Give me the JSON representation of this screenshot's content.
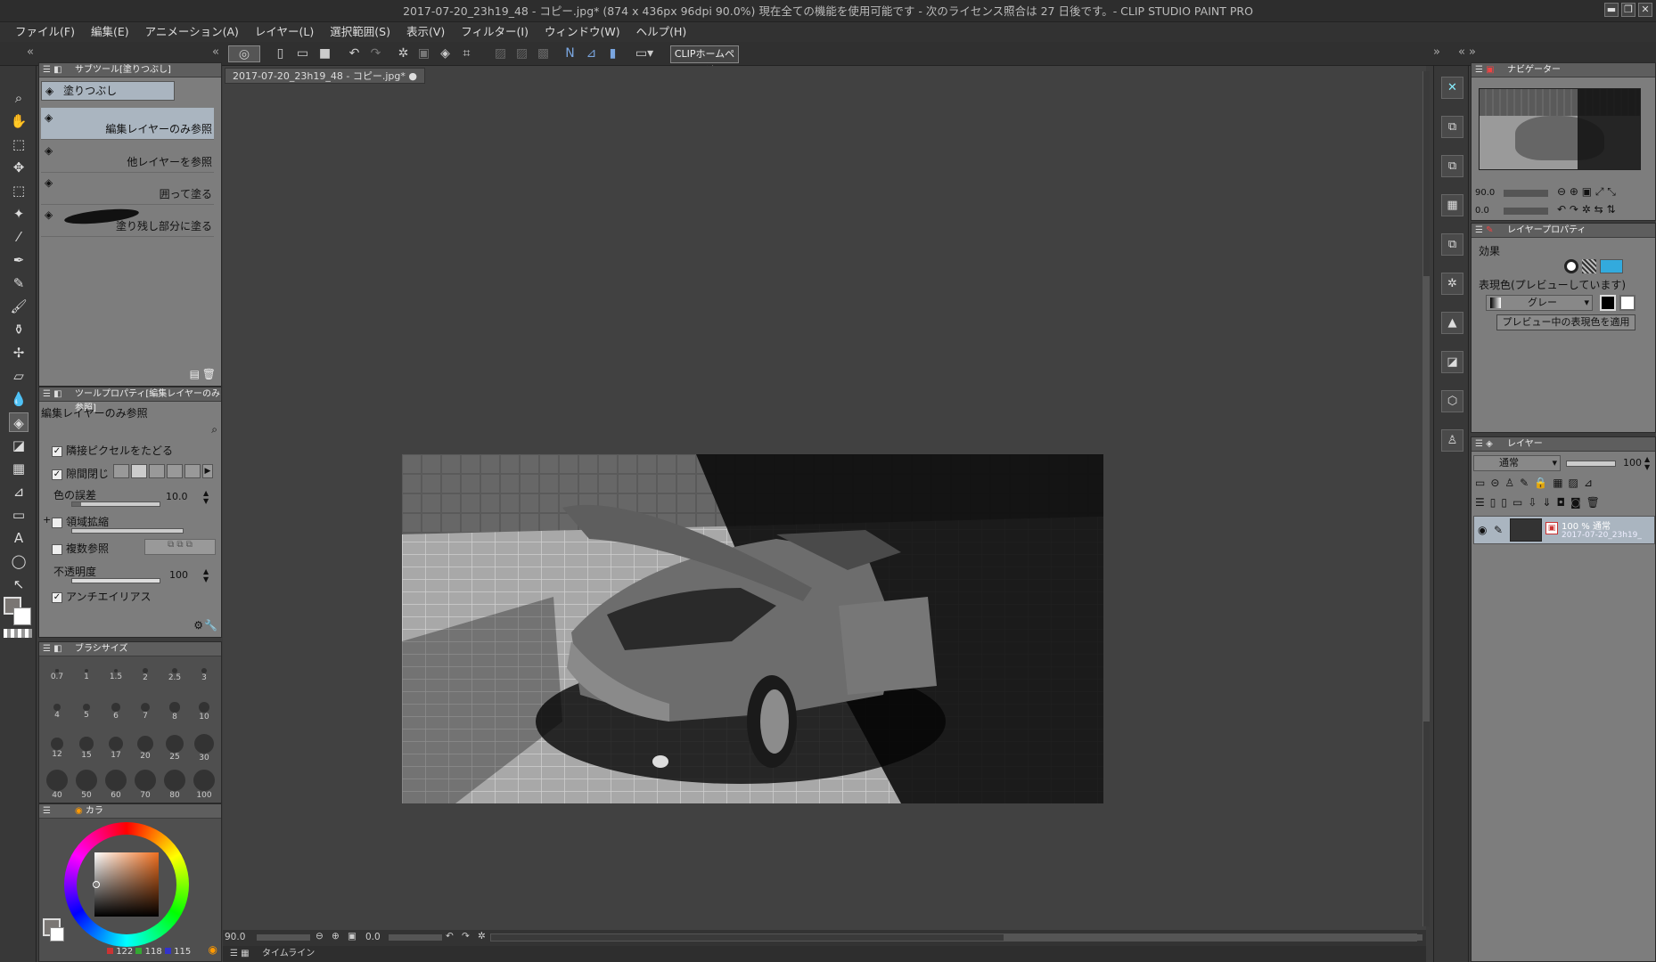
{
  "window": {
    "title": "2017-07-20_23h19_48 - コピー.jpg* (874 x 436px 96dpi 90.0%)  現在全ての機能を使用可能です - 次のライセンス照合は 27 日後です。- CLIP STUDIO PAINT PRO",
    "minimize": "▬",
    "restore": "❐",
    "close": "✕"
  },
  "menu": [
    "ファイル(F)",
    "編集(E)",
    "アニメーション(A)",
    "レイヤー(L)",
    "選択範囲(S)",
    "表示(V)",
    "フィルター(I)",
    "ウィンドウ(W)",
    "ヘルプ(H)"
  ],
  "toolbar": {
    "home_label": "CLIPホームページ"
  },
  "subtool": {
    "header": "サブツール[塗りつぶし]",
    "group_label": "塗りつぶし",
    "items": [
      "編集レイヤーのみ参照",
      "他レイヤーを参照",
      "囲って塗る",
      "塗り残し部分に塗る"
    ]
  },
  "tool_property": {
    "header": "ツールプロパティ[編集レイヤーのみ参照]",
    "title": "編集レイヤーのみ参照",
    "adjacent_label": "隣接ピクセルをたどる",
    "gap_label": "隙間閉じ",
    "color_margin_label": "色の誤差",
    "color_margin_value": "10.0",
    "area_scaling_label": "領域拡縮",
    "multi_ref_label": "複数参照",
    "opacity_label": "不透明度",
    "opacity_value": "100",
    "antialias_label": "アンチエイリアス"
  },
  "brush_size": {
    "header": "ブラシサイズ",
    "sizes": [
      "0.7",
      "1",
      "1.5",
      "2",
      "2.5",
      "3",
      "4",
      "5",
      "6",
      "7",
      "8",
      "10",
      "12",
      "15",
      "17",
      "20",
      "25",
      "30",
      "40",
      "50",
      "60",
      "70",
      "80",
      "100"
    ]
  },
  "color": {
    "header": "カラ",
    "r": "122",
    "g": "118",
    "b": "115",
    "main_color": "#7a7673"
  },
  "canvas": {
    "doc_tab": "2017-07-20_23h19_48 - コピー.jpg*",
    "zoom": "90.0",
    "rotation": "0.0"
  },
  "timeline": {
    "label": "タイムライン"
  },
  "navigator": {
    "header": "ナビゲーター",
    "zoom": "90.0",
    "rotation": "0.0"
  },
  "layer_property": {
    "header": "レイヤープロパティ",
    "effect_label": "効果",
    "expression_label": "表現色(プレビューしています)",
    "expression_value": "グレー",
    "apply_button": "プレビュー中の表現色を適用"
  },
  "layers": {
    "header": "レイヤー",
    "blend_mode": "通常",
    "opacity": "100",
    "items": [
      {
        "mode": "100 % 通常",
        "name": "2017-07-20_23h19_"
      }
    ]
  }
}
